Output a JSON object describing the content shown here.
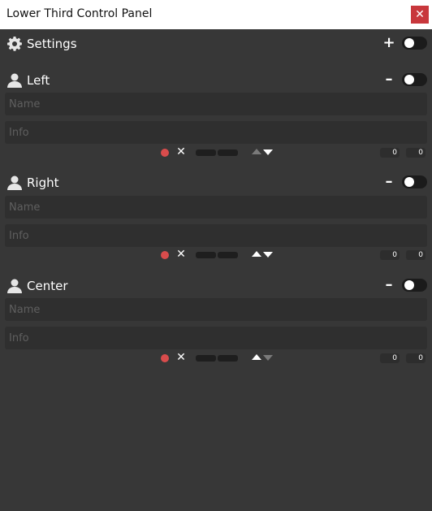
{
  "window": {
    "title": "Lower Third Control Panel",
    "close_glyph": "✕",
    "accent_close": "#c8373c"
  },
  "settings": {
    "label": "Settings",
    "icon": "gear-icon",
    "add_glyph": "+",
    "toggle_on": false
  },
  "rows": [
    {
      "label": "Left",
      "icon": "person-icon",
      "remove_glyph": "–",
      "toggle_on": false,
      "name_placeholder": "Name",
      "info_placeholder": "Info",
      "clear_glyph": "✕",
      "value_1": "0",
      "value_2": "0",
      "up_enabled": false,
      "down_enabled": true
    },
    {
      "label": "Right",
      "icon": "person-icon",
      "remove_glyph": "–",
      "toggle_on": false,
      "name_placeholder": "Name",
      "info_placeholder": "Info",
      "clear_glyph": "✕",
      "value_1": "0",
      "value_2": "0",
      "up_enabled": true,
      "down_enabled": true
    },
    {
      "label": "Center",
      "icon": "person-icon",
      "remove_glyph": "–",
      "toggle_on": false,
      "name_placeholder": "Name",
      "info_placeholder": "Info",
      "clear_glyph": "✕",
      "value_1": "0",
      "value_2": "0",
      "up_enabled": true,
      "down_enabled": false
    }
  ],
  "colors": {
    "background": "#373737",
    "field": "#2f2f2f",
    "record_dot": "#d94c4c"
  }
}
